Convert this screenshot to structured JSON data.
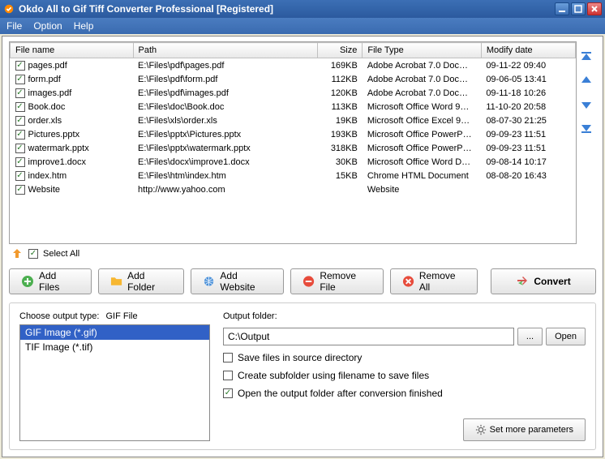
{
  "window": {
    "title": "Okdo All to Gif Tiff Converter Professional [Registered]"
  },
  "menu": {
    "file": "File",
    "option": "Option",
    "help": "Help"
  },
  "table": {
    "headers": {
      "name": "File name",
      "path": "Path",
      "size": "Size",
      "type": "File Type",
      "date": "Modify date"
    },
    "rows": [
      {
        "checked": true,
        "name": "pages.pdf",
        "path": "E:\\Files\\pdf\\pages.pdf",
        "size": "169KB",
        "type": "Adobe Acrobat 7.0 Doc…",
        "date": "09-11-22 09:40"
      },
      {
        "checked": true,
        "name": "form.pdf",
        "path": "E:\\Files\\pdf\\form.pdf",
        "size": "112KB",
        "type": "Adobe Acrobat 7.0 Doc…",
        "date": "09-06-05 13:41"
      },
      {
        "checked": true,
        "name": "images.pdf",
        "path": "E:\\Files\\pdf\\images.pdf",
        "size": "120KB",
        "type": "Adobe Acrobat 7.0 Doc…",
        "date": "09-11-18 10:26"
      },
      {
        "checked": true,
        "name": "Book.doc",
        "path": "E:\\Files\\doc\\Book.doc",
        "size": "113KB",
        "type": "Microsoft Office Word 9…",
        "date": "11-10-20 20:58"
      },
      {
        "checked": true,
        "name": "order.xls",
        "path": "E:\\Files\\xls\\order.xls",
        "size": "19KB",
        "type": "Microsoft Office Excel 9…",
        "date": "08-07-30 21:25"
      },
      {
        "checked": true,
        "name": "Pictures.pptx",
        "path": "E:\\Files\\pptx\\Pictures.pptx",
        "size": "193KB",
        "type": "Microsoft Office PowerP…",
        "date": "09-09-23 11:51"
      },
      {
        "checked": true,
        "name": "watermark.pptx",
        "path": "E:\\Files\\pptx\\watermark.pptx",
        "size": "318KB",
        "type": "Microsoft Office PowerP…",
        "date": "09-09-23 11:51"
      },
      {
        "checked": true,
        "name": "improve1.docx",
        "path": "E:\\Files\\docx\\improve1.docx",
        "size": "30KB",
        "type": "Microsoft Office Word D…",
        "date": "09-08-14 10:17"
      },
      {
        "checked": true,
        "name": "index.htm",
        "path": "E:\\Files\\htm\\index.htm",
        "size": "15KB",
        "type": "Chrome HTML Document",
        "date": "08-08-20 16:43"
      },
      {
        "checked": true,
        "name": "Website",
        "path": "http://www.yahoo.com",
        "size": "",
        "type": "Website",
        "date": ""
      }
    ]
  },
  "selectAll": {
    "label": "Select All",
    "checked": true
  },
  "buttons": {
    "addFiles": "Add Files",
    "addFolder": "Add Folder",
    "addWebsite": "Add Website",
    "removeFile": "Remove File",
    "removeAll": "Remove All",
    "convert": "Convert"
  },
  "outputType": {
    "chooseLabel": "Choose output type:",
    "current": "GIF File",
    "items": [
      {
        "label": "GIF Image (*.gif)",
        "selected": true
      },
      {
        "label": "TIF Image (*.tif)",
        "selected": false
      }
    ]
  },
  "outputFolder": {
    "label": "Output folder:",
    "value": "C:\\Output",
    "browse": "...",
    "open": "Open"
  },
  "options": {
    "saveInSource": {
      "label": "Save files in source directory",
      "checked": false
    },
    "createSubfolder": {
      "label": "Create subfolder using filename to save files",
      "checked": false
    },
    "openAfter": {
      "label": "Open the output folder after conversion finished",
      "checked": true
    }
  },
  "moreParams": "Set more parameters"
}
